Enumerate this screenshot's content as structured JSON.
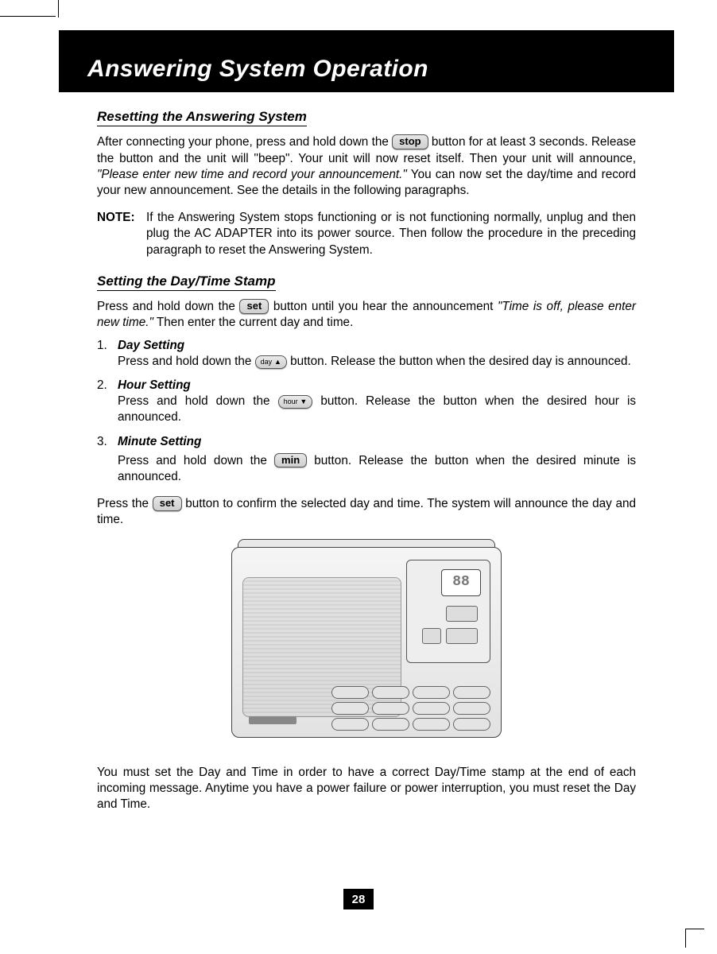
{
  "page_number": "28",
  "banner_title": "Answering System Operation",
  "section1": {
    "heading": "Resetting the Answering System",
    "p1a": "After connecting your phone, press and hold down the ",
    "btn_stop": "stop",
    "p1b": " button for at least 3 seconds. Release the button and the unit will \"beep\". Your unit will now reset itself. Then your unit will announce, ",
    "p1c_italic": "\"Please enter new time and record your announcement.\"",
    "p1d": " You can now set the day/time and record your new announcement. See the details in the following paragraphs.",
    "note_label": "NOTE:",
    "note_text": "If the Answering System stops functioning or is not functioning normally, unplug and then plug the AC ADAPTER into its power source. Then follow the procedure in the preceding paragraph to reset the Answering System."
  },
  "section2": {
    "heading": "Setting the Day/Time Stamp",
    "intro_a": "Press and hold down the ",
    "btn_set": "set",
    "intro_b": " button until you hear the announcement ",
    "intro_italic": "\"Time is off, please enter new time.\"",
    "intro_c": " Then enter the current day and time.",
    "items": [
      {
        "num": "1.",
        "title": "Day Setting",
        "a": "Press and hold down the ",
        "btn_label": "day ▲",
        "b": " button. Release the button when the desired day is announced."
      },
      {
        "num": "2.",
        "title": "Hour Setting",
        "a": "Press and hold down the ",
        "btn_label": "hour ▼",
        "b": " button. Release the button when the desired hour is announced."
      },
      {
        "num": "3.",
        "title": "Minute Setting",
        "a": "Press and hold down the ",
        "btn_label": "min",
        "b": " button. Release the button when the desired minute is announced."
      }
    ],
    "confirm_a": "Press the ",
    "confirm_b": " button to confirm the selected day and time. The system will announce the day and time.",
    "closing": "You must set the Day and Time in order to have a correct Day/Time stamp at the end of each incoming message. Anytime you have a power failure or power interruption, you must reset the Day and Time."
  },
  "device_lcd": "88"
}
